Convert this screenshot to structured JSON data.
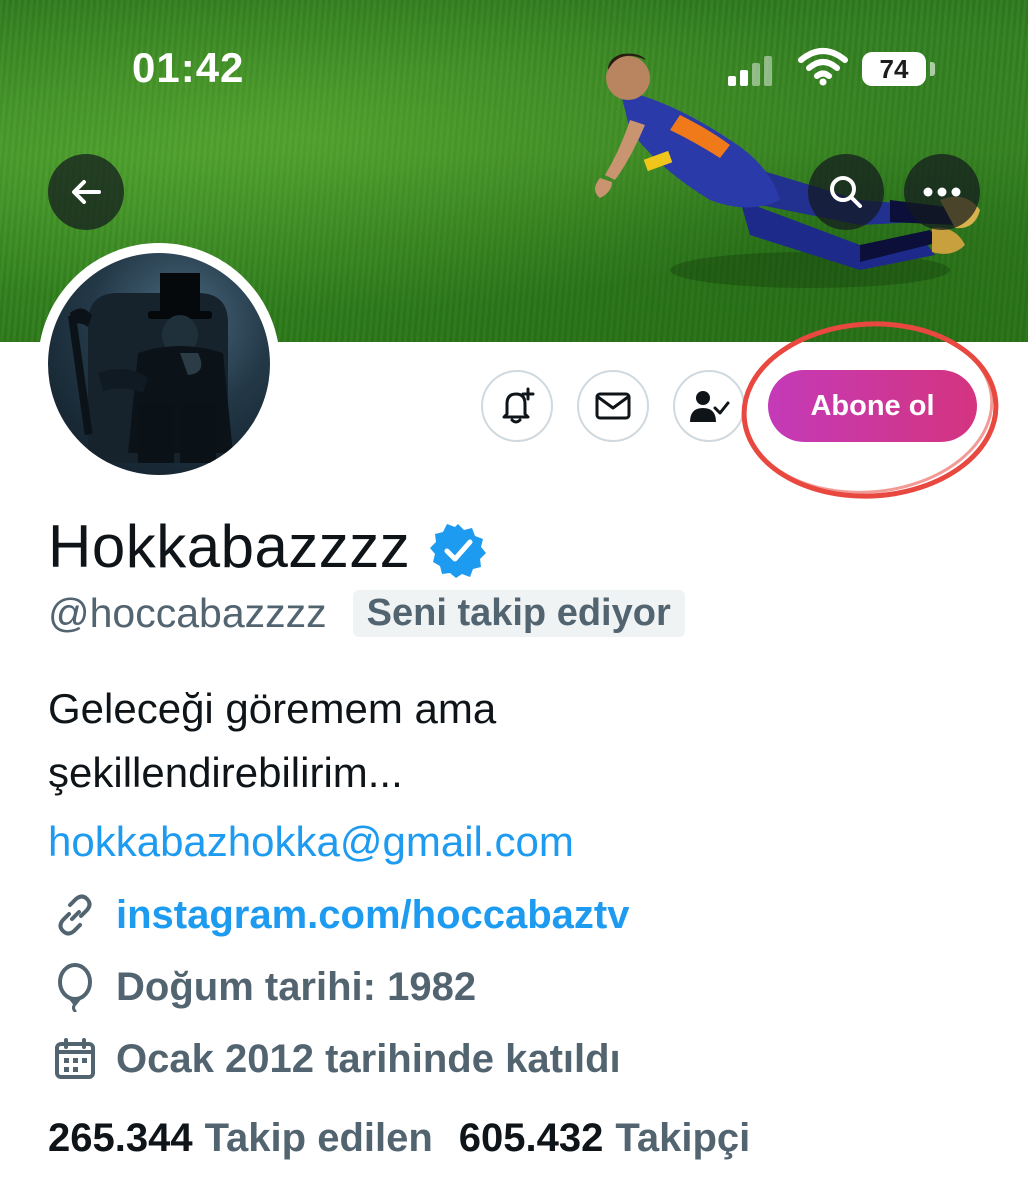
{
  "status_bar": {
    "time": "01:42",
    "battery": "74"
  },
  "header": {
    "back_icon": "arrow-left-icon",
    "search_icon": "search-icon",
    "more_icon": "more-horizontal-icon"
  },
  "actions": {
    "notify_icon": "bell-plus-icon",
    "message_icon": "mail-icon",
    "following_icon": "person-check-icon",
    "subscribe_label": "Abone ol"
  },
  "profile": {
    "display_name": "Hokkabazzzz",
    "verified": true,
    "handle": "@hoccabazzzz",
    "follows_you": "Seni takip ediyor",
    "bio_line1": "Geleceği göremem ama",
    "bio_line2": "şekillendirebilirim...",
    "email": "hokkabazhokka@gmail.com",
    "website": "instagram.com/hoccabaztv",
    "birthday": "Doğum tarihi: 1982",
    "joined": "Ocak 2012 tarihinde katıldı"
  },
  "stats": {
    "following_count": "265.344",
    "following_label": "Takip edilen",
    "followers_count": "605.432",
    "followers_label": "Takipçi"
  },
  "colors": {
    "accent": "#1d9bf0",
    "secondary_text": "#536471",
    "subscribe_gradient_start": "#c43ab8",
    "subscribe_gradient_end": "#d4347f",
    "highlight_ring": "#e8483f"
  }
}
